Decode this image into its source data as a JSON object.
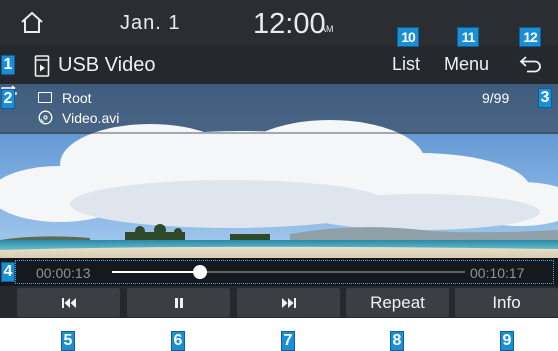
{
  "status_bar": {
    "home_icon": "home-icon",
    "date": "Jan.  1",
    "time": "12:00",
    "ampm": "AM"
  },
  "title_bar": {
    "source_icon": "usb-video-file-icon",
    "source_label": "USB Video",
    "list_label": "List",
    "menu_label": "Menu",
    "back_icon": "back-arrow-icon"
  },
  "info_overlay": {
    "folder_icon": "folder-icon",
    "folder": "Root",
    "file_icon": "video-disc-icon",
    "file": "Video.avi",
    "repeat_icon": "repeat-icon",
    "track_count": "9/99"
  },
  "progress": {
    "elapsed": "00:00:13",
    "duration": "00:10:17",
    "fraction": 0.25
  },
  "controls": {
    "prev_icon": "skip-previous-icon",
    "pause_icon": "pause-icon",
    "next_icon": "skip-next-icon",
    "repeat_label": "Repeat",
    "info_label": "Info"
  },
  "callouts": [
    "1",
    "2",
    "3",
    "4",
    "5",
    "6",
    "7",
    "8",
    "9",
    "10",
    "11",
    "12"
  ],
  "colors": {
    "accent": "#1a8fd6",
    "background": "#1f2226",
    "button": "#3b3f44"
  }
}
